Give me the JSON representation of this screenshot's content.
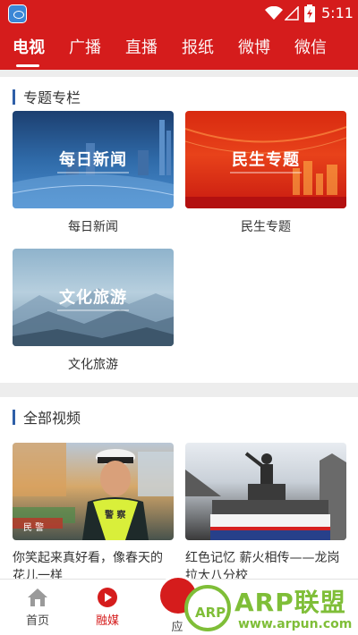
{
  "status_bar": {
    "time": "5:11"
  },
  "tabs": [
    {
      "label": "电视",
      "active": true
    },
    {
      "label": "广播"
    },
    {
      "label": "直播"
    },
    {
      "label": "报纸"
    },
    {
      "label": "微博"
    },
    {
      "label": "微信"
    }
  ],
  "section_special": {
    "title": "专题专栏",
    "cards": [
      {
        "thumb_label": "每日新闻",
        "caption": "每日新闻"
      },
      {
        "thumb_label": "民生专题",
        "caption": "民生专题"
      },
      {
        "thumb_label": "文化旅游",
        "caption": "文化旅游"
      }
    ]
  },
  "section_videos": {
    "title": "全部视频",
    "items": [
      {
        "caption": "你笑起来真好看，像春天的花儿一样",
        "badge": "民 警",
        "vest_text": "警 察"
      },
      {
        "caption": "红色记忆 薪火相传——龙岗拉大八分校"
      }
    ]
  },
  "bottom_nav": [
    {
      "label": "首页",
      "icon": "home-icon"
    },
    {
      "label": "融媒",
      "icon": "play-icon",
      "active": true
    },
    {
      "label": "应",
      "icon": "apps-icon"
    }
  ],
  "watermark": {
    "circle_text": "ARP",
    "title": "ARP联盟",
    "url": "www.arpun.com"
  },
  "colors": {
    "brand_red": "#d51c1c",
    "section_bar_blue": "#2f5fa8",
    "watermark_green": "#7fbe38"
  }
}
